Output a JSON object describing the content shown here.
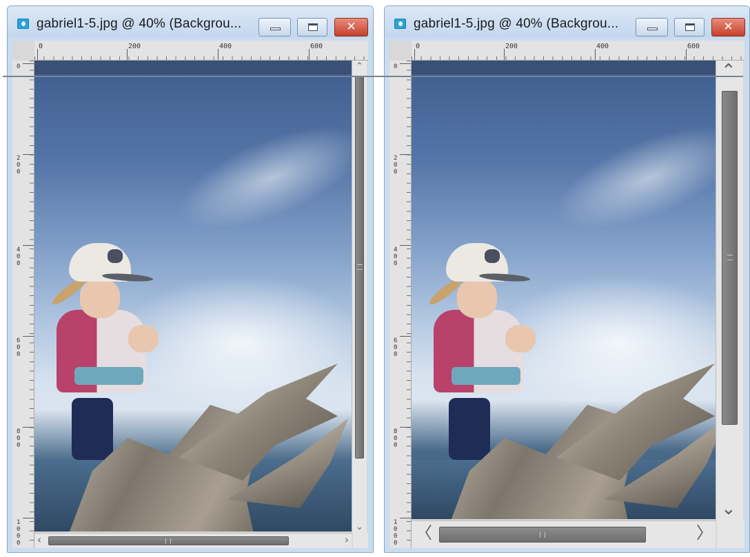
{
  "windows": [
    {
      "id": "left",
      "title": "gabriel1-5.jpg @  40% (Backgrou...",
      "ruler": {
        "h_labels": [
          "0",
          "200",
          "400",
          "600"
        ],
        "v_labels": [
          "0",
          "200",
          "400",
          "600",
          "800",
          "1000"
        ]
      },
      "controls": {
        "close_glyph": "✕"
      },
      "arrows": {
        "up": "⌃",
        "down": "⌄",
        "left": "‹",
        "right": "›"
      },
      "scroll": {
        "vertical_thumb_fraction": 0.86,
        "horizontal_thumb_fraction": 0.83
      }
    },
    {
      "id": "right",
      "title": "gabriel1-5.jpg @  40% (Backgrou...",
      "ruler": {
        "h_labels": [
          "0",
          "200",
          "400",
          "600"
        ],
        "v_labels": [
          "0",
          "200",
          "400",
          "600",
          "800",
          "1000"
        ]
      },
      "controls": {
        "close_glyph": "✕"
      },
      "arrows": {
        "up": "⌃",
        "down": "⌄",
        "left": "〈",
        "right": "〉"
      },
      "scroll": {
        "vertical_thumb_fraction": 0.83,
        "horizontal_thumb_fraction": 0.83
      }
    }
  ],
  "colors": {
    "title_bar": "#c9dcf0",
    "close_button": "#c6402c",
    "ruler": "#e3e3e3",
    "scroll_thumb": "#7a7a7a"
  },
  "icons": [
    "app-image-icon",
    "minimize-icon",
    "maximize-icon",
    "close-icon",
    "scroll-arrow-icon"
  ]
}
